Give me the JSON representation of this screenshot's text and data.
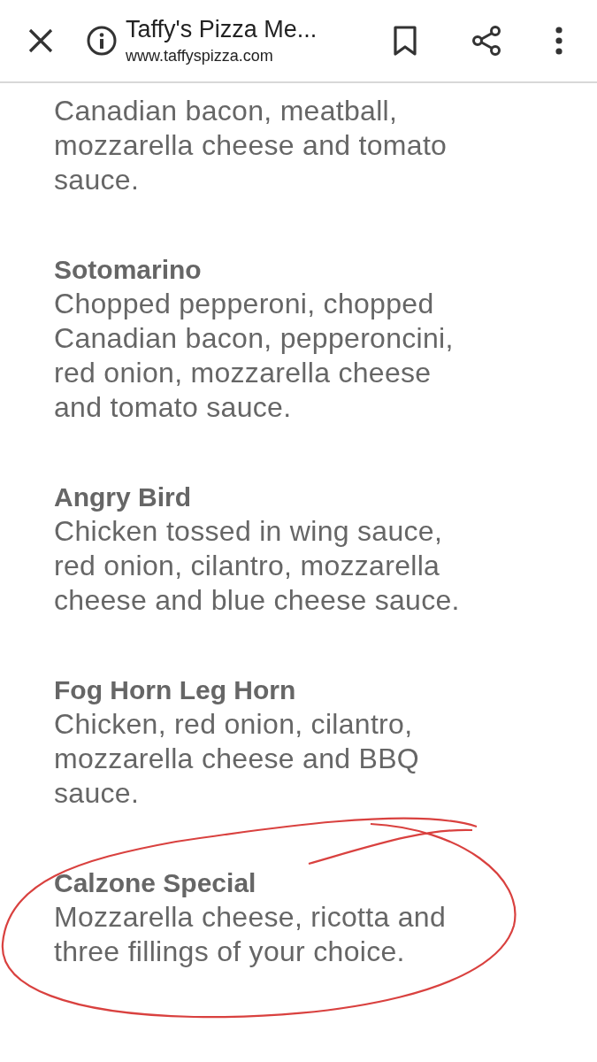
{
  "toolbar": {
    "title": "Taffy's Pizza Me...",
    "url": "www.taffyspizza.com"
  },
  "menu_items": [
    {
      "description": "Canadian bacon, meatball, mozzarella cheese and tomato sauce.",
      "highlighted": false
    },
    {
      "name": "Sotomarino",
      "description": "Chopped pepperoni, chopped Canadian bacon, pepperoncini, red onion, mozzarella cheese and tomato sauce.",
      "highlighted": false
    },
    {
      "name": "Angry Bird",
      "description": "Chicken tossed in wing sauce, red onion, cilantro, mozzarella cheese and blue cheese sauce.",
      "highlighted": false
    },
    {
      "name": "Fog Horn Leg Horn",
      "description": "Chicken, red onion, cilantro, mozzarella cheese and BBQ sauce.",
      "highlighted": false
    },
    {
      "name": "Calzone Special",
      "description": "Mozzarella cheese, ricotta and three fillings of your choice.",
      "highlighted": true
    }
  ]
}
